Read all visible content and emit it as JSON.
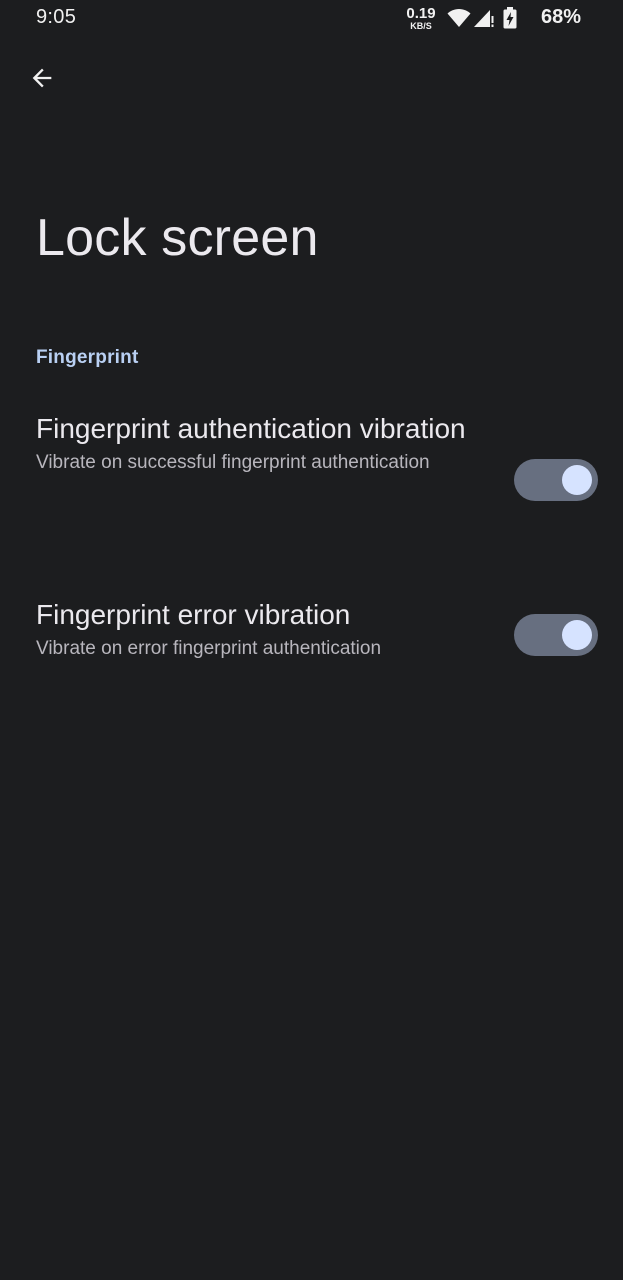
{
  "status_bar": {
    "time": "9:05",
    "net_speed_value": "0.19",
    "net_speed_unit": "KB/S",
    "battery": "68%",
    "icons": [
      "wifi-icon",
      "signal-icon",
      "battery-charging-icon"
    ]
  },
  "header": {
    "back_icon": "arrow-back-icon",
    "title": "Lock screen"
  },
  "sections": [
    {
      "header": "Fingerprint",
      "items": [
        {
          "title": "Fingerprint authentication vibration",
          "summary": "Vibrate on successful fingerprint authentication",
          "enabled": true
        },
        {
          "title": "Fingerprint error vibration",
          "summary": "Vibrate on error fingerprint authentication",
          "enabled": true
        }
      ]
    }
  ],
  "colors": {
    "background": "#1c1d1f",
    "accent": "#b9d0f3",
    "switch_track_on": "#676f80",
    "switch_thumb_on": "#d6e3ff"
  }
}
